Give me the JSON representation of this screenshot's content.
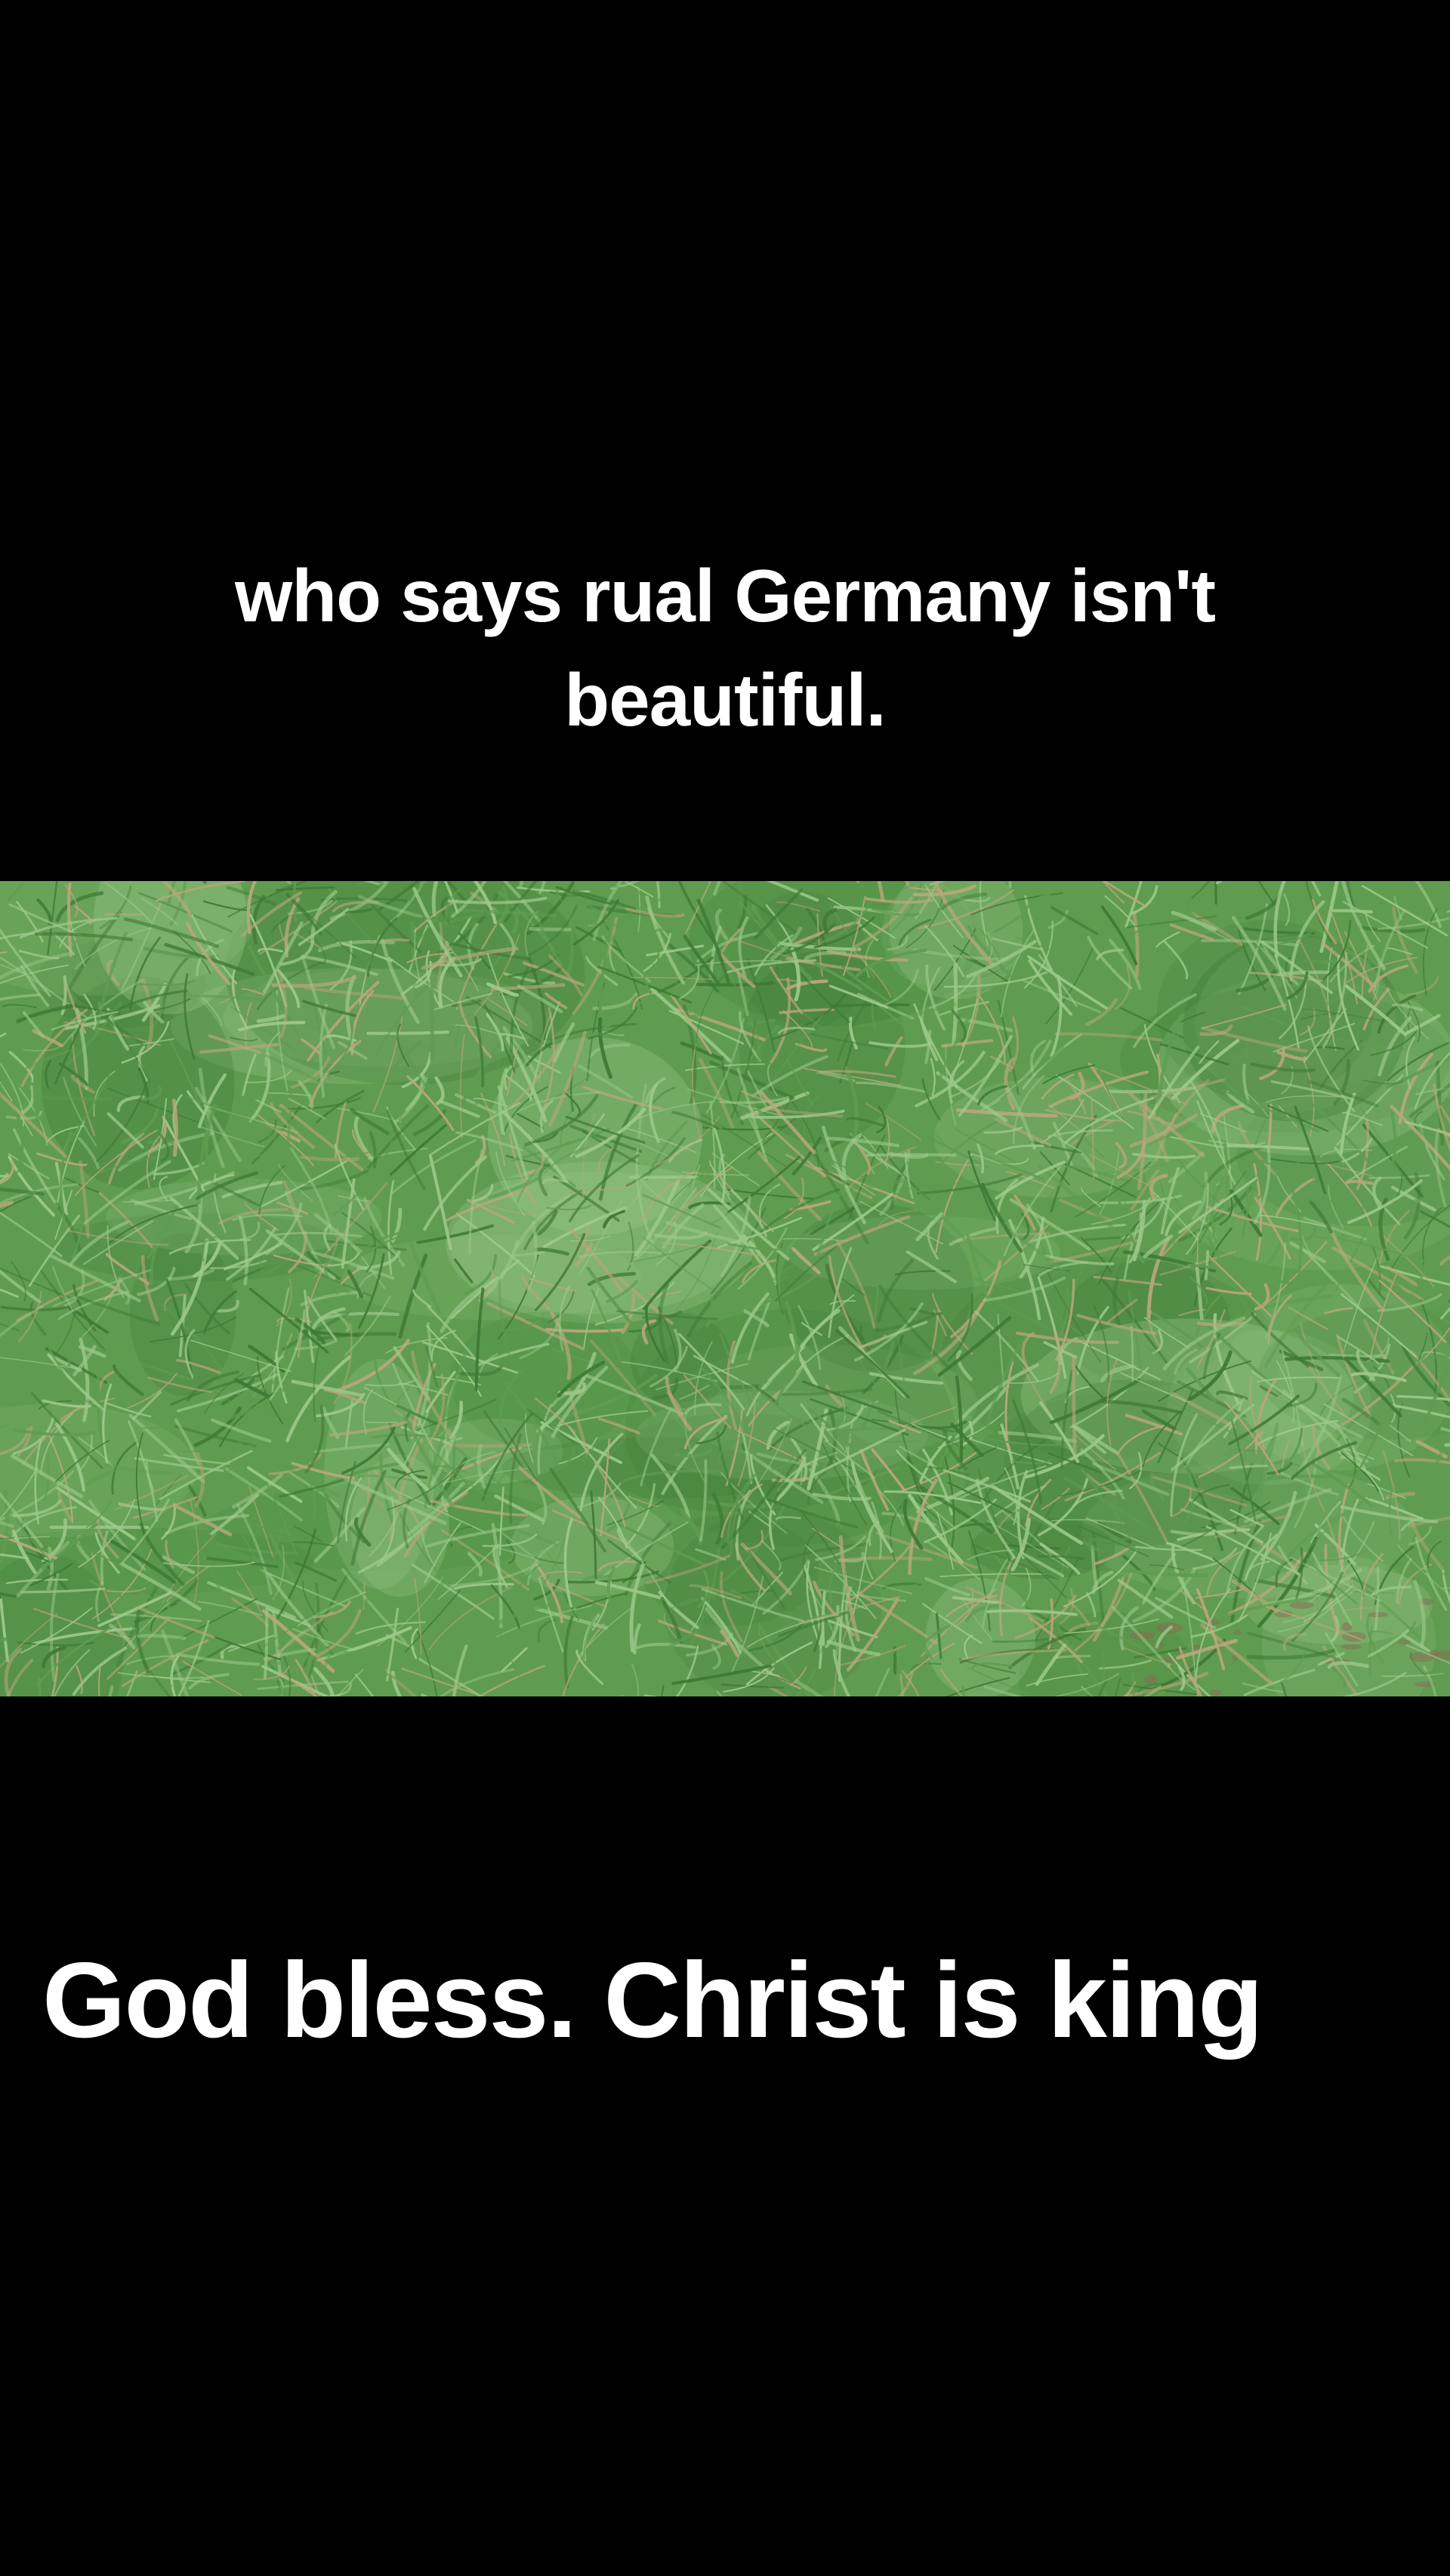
{
  "captions": {
    "top_line_1": "who says rual Germany isn't",
    "top_line_2": "beautiful.",
    "bottom": "God bless. Christ is king"
  },
  "video": {
    "subject": "grass-lawn-closeup",
    "colors": {
      "base": "#5f9c4f",
      "dark": "#3f7a35",
      "light": "#9cc98a",
      "dry": "#b9a77a",
      "soil": "#8a6a55"
    }
  }
}
